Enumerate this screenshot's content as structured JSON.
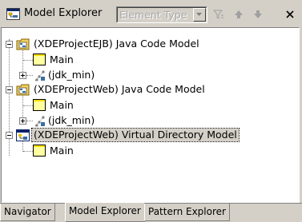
{
  "view": {
    "title": "Model Explorer",
    "filter_placeholder": "Element Type",
    "toolbar_icons": [
      "filter-icon",
      "up-arrow-icon",
      "down-arrow-icon",
      "close-icon"
    ]
  },
  "tree": {
    "nodes": [
      {
        "label": "(XDEProjectEJB) Java Code Model",
        "icon": "java-model-icon",
        "expanded": true
      },
      {
        "label": "Main",
        "icon": "diagram-icon"
      },
      {
        "label": "(jdk_min)",
        "icon": "library-icon",
        "expanded": false
      },
      {
        "label": "(XDEProjectWeb) Java Code Model",
        "icon": "java-model-icon",
        "expanded": true
      },
      {
        "label": "Main",
        "icon": "diagram-icon"
      },
      {
        "label": "(jdk_min)",
        "icon": "library-icon",
        "expanded": false
      },
      {
        "label": "(XDEProjectWeb) Virtual Directory Model",
        "icon": "virtual-directory-icon",
        "expanded": true,
        "selected": true
      },
      {
        "label": "Main",
        "icon": "diagram-icon"
      }
    ]
  },
  "tabs": [
    {
      "label": "Navigator"
    },
    {
      "label": "Model Explorer",
      "active": true
    },
    {
      "label": "Pattern Explorer"
    }
  ]
}
